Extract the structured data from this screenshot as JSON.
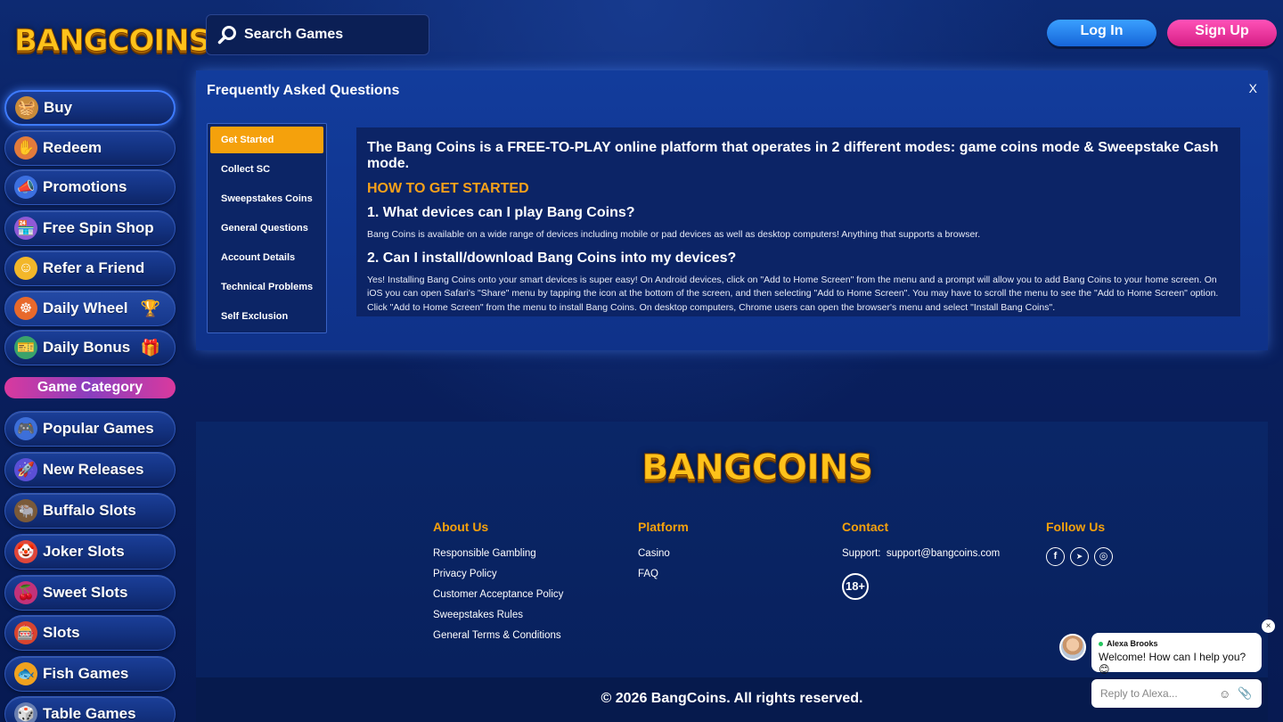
{
  "brand": {
    "logo_text": "BANGCOINS"
  },
  "search": {
    "placeholder": "Search Games"
  },
  "auth": {
    "login_label": "Log In",
    "signup_label": "Sign Up"
  },
  "sidebar": {
    "items": [
      {
        "label": "Buy",
        "icon": "basket-icon"
      },
      {
        "label": "Redeem",
        "icon": "hand-coin-icon"
      },
      {
        "label": "Promotions",
        "icon": "megaphone-icon"
      },
      {
        "label": "Free Spin Shop",
        "icon": "shop-icon"
      },
      {
        "label": "Refer a Friend",
        "icon": "coin-person-icon"
      },
      {
        "label": "Daily Wheel",
        "icon": "wheel-icon"
      },
      {
        "label": "Daily Bonus",
        "icon": "ticket-icon"
      }
    ],
    "game_category_label": "Game Category",
    "categories": [
      {
        "label": "Popular Games",
        "icon": "gamepad-icon"
      },
      {
        "label": "New Releases",
        "icon": "rocket-icon"
      },
      {
        "label": "Buffalo Slots",
        "icon": "buffalo-icon"
      },
      {
        "label": "Joker Slots",
        "icon": "joker-icon"
      },
      {
        "label": "Sweet Slots",
        "icon": "cherry-icon"
      },
      {
        "label": "Slots",
        "icon": "slot-machine-icon"
      },
      {
        "label": "Fish Games",
        "icon": "fish-icon"
      },
      {
        "label": "Table Games",
        "icon": "dice-icon"
      }
    ]
  },
  "faq": {
    "title": "Frequently Asked Questions",
    "close_label": "X",
    "tabs": [
      "Get Started",
      "Collect SC",
      "Sweepstakes Coins",
      "General Questions",
      "Account Details",
      "Technical Problems",
      "Self Exclusion"
    ],
    "selected_tab": "Get Started",
    "content": {
      "headline": "The Bang Coins is a FREE-TO-PLAY online platform that operates in 2 different modes: game coins mode & Sweepstake Cash mode.",
      "subhead": "HOW TO GET STARTED",
      "q1": "1. What devices can I play Bang Coins?",
      "a1": "Bang Coins is available on a wide range of devices including mobile or pad devices as well as desktop computers! Anything that supports a browser.",
      "q2": "2. Can I install/download Bang Coins into my devices?",
      "a2": "Yes! Installing Bang Coins onto your smart devices is super easy! On Android devices, click on \"Add to Home Screen\" from the menu and a prompt will allow you to add Bang Coins to your home screen. On iOS you can open Safari's \"Share\" menu by tapping the icon at the bottom of the screen, and then selecting \"Add to Home Screen\". You may have to scroll the menu to see the \"Add to Home Screen\" option. Click \"Add to Home Screen\" from the menu to install Bang Coins. On desktop computers, Chrome users can open the browser's menu and select \"Install Bang Coins\"."
    }
  },
  "footer": {
    "about": {
      "title": "About Us",
      "links": [
        "Responsible Gambling",
        "Privacy Policy",
        "Customer Acceptance Policy",
        "Sweepstakes Rules",
        "General Terms & Conditions"
      ]
    },
    "platform": {
      "title": "Platform",
      "links": [
        "Casino",
        "FAQ"
      ]
    },
    "contact": {
      "title": "Contact",
      "support_label": "Support:",
      "support_email": "support@bangcoins.com",
      "age_badge": "18+"
    },
    "follow": {
      "title": "Follow Us",
      "icons": [
        "facebook-icon",
        "telegram-icon",
        "instagram-icon"
      ],
      "glyphs": [
        "f",
        "➤",
        "◎"
      ]
    },
    "copyright": "© 2026 BangCoins. All rights reserved."
  },
  "chat": {
    "agent_name": "Alexa Brooks",
    "message": "Welcome! How can I help you? 😊",
    "input_placeholder": "Reply to Alexa...",
    "close_label": "×"
  },
  "colors": {
    "accent_orange": "#f5a10c",
    "login_blue": "#1f7ae6",
    "signup_pink": "#e4309a",
    "background": "#0a1f5e"
  }
}
